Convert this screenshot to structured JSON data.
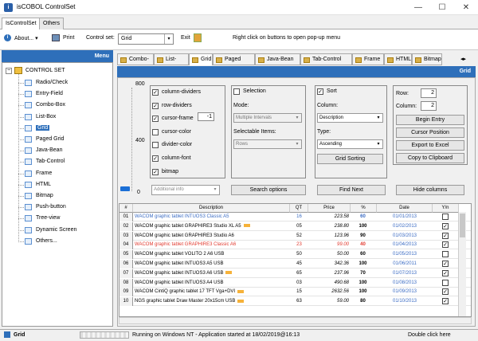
{
  "window": {
    "title": "isCOBOL ControlSet",
    "min": "—",
    "max": "☐",
    "close": "✕"
  },
  "top_tabs": [
    "IsControlSet",
    "Others"
  ],
  "toolbar": {
    "about": "About...",
    "print": "Print",
    "control_set_label": "Control set:",
    "control_set_value": "Grid",
    "exit": "Exit",
    "hint": "Right click on buttons to open pop-up menu"
  },
  "menu_header": "Menu",
  "tree": {
    "root": "CONTROL SET",
    "items": [
      "Radio/Check",
      "Entry-Field",
      "Combo-Box",
      "List-Box",
      "Grid",
      "Paged Grid",
      "Java-Bean",
      "Tab-Control",
      "Frame",
      "HTML",
      "Bitmap",
      "Push-button",
      "Tree-view",
      "Dynamic Screen",
      "Others..."
    ]
  },
  "content_tabs": [
    "Combo-Box",
    "List-Box",
    "Grid",
    "Paged Grid",
    "Java-Bean",
    "Tab-Control",
    "Frame",
    "HTML",
    "Bitmap"
  ],
  "grid_header": "Grid",
  "slider": {
    "ticks": [
      "800",
      "400",
      "0"
    ]
  },
  "options": {
    "checks": [
      {
        "label": "column-dividers",
        "checked": true
      },
      {
        "label": "row-dividers",
        "checked": true
      },
      {
        "label": "cursor-frame",
        "checked": true
      },
      {
        "label": "cursor-color",
        "checked": false
      },
      {
        "label": "divider-color",
        "checked": false
      },
      {
        "label": "column-font",
        "checked": true
      },
      {
        "label": "bitmap",
        "checked": true
      }
    ],
    "cursor_frame_value": "-1",
    "additional_info_placeholder": "Additional info"
  },
  "selection": {
    "label": "Selection",
    "mode_label": "Mode:",
    "mode_value": "Multiple Intervals",
    "selectable_label": "Selectable Items:",
    "selectable_value": "Rows",
    "search_button": "Search options"
  },
  "sort": {
    "label": "Sort",
    "column_label": "Column:",
    "column_value": "Description",
    "type_label": "Type:",
    "type_value": "Ascending",
    "sorting_button": "Grid Sorting",
    "find_button": "Find Next"
  },
  "cursor": {
    "row_label": "Row:",
    "row_value": "2",
    "column_label": "Column:",
    "column_value": "2",
    "begin_entry": "Begin Entry",
    "cursor_position": "Cursor Position",
    "export_excel": "Export to Excel",
    "copy_clipboard": "Copy to Clipboard",
    "hide_columns": "Hide columns"
  },
  "table": {
    "columns": [
      "#",
      "Description",
      "QT",
      "Price",
      "%",
      "Date",
      "Y/n"
    ],
    "rows": [
      {
        "n": "01",
        "desc": "WACOM graphic tablet INTUOS3 Classic A5",
        "qt": "16",
        "price": "223.58",
        "pct": "60",
        "date": "01/01/2013",
        "yn": false,
        "style": "blue",
        "new": false
      },
      {
        "n": "02",
        "desc": "WACOM graphic tablet GRAPHIRE3 Studio XL A5",
        "qt": "05",
        "price": "238.80",
        "pct": "100",
        "date": "01/02/2013",
        "yn": true,
        "style": "normal",
        "new": true
      },
      {
        "n": "03",
        "desc": "WACOM graphic tablet GRAPHIRE3 Studio A6",
        "qt": "52",
        "price": "123.96",
        "pct": "90",
        "date": "01/03/2013",
        "yn": true,
        "style": "normal",
        "new": false
      },
      {
        "n": "04",
        "desc": "WACOM graphic tablet GRAPHIRE3 Classic A6",
        "qt": "23",
        "price": "99.00",
        "pct": "40",
        "date": "01/04/2013",
        "yn": true,
        "style": "red",
        "new": false
      },
      {
        "n": "05",
        "desc": "WACOM graphic tablet VOLITO 2 A6 USB",
        "qt": "50",
        "price": "50.00",
        "pct": "60",
        "date": "01/05/2013",
        "yn": false,
        "style": "normal",
        "new": false
      },
      {
        "n": "06",
        "desc": "WACOM graphic tablet INTUOS3 A5 USB",
        "qt": "45",
        "price": "342.36",
        "pct": "100",
        "date": "01/06/2011",
        "yn": true,
        "style": "normal",
        "new": false
      },
      {
        "n": "07",
        "desc": "WACOM graphic tablet INTUOS3 A6 USB",
        "qt": "65",
        "price": "237.96",
        "pct": "70",
        "date": "01/07/2013",
        "yn": true,
        "style": "normal",
        "new": true
      },
      {
        "n": "08",
        "desc": "WACOM graphic tablet INTUOS3 A4 USB",
        "qt": "03",
        "price": "490.68",
        "pct": "100",
        "date": "01/08/2013",
        "yn": false,
        "style": "normal",
        "new": false
      },
      {
        "n": "09",
        "desc": "WACOM CintiQ graphic tablet 17 TFT Vga+DVI",
        "qt": "15",
        "price": "2632.56",
        "pct": "100",
        "date": "01/09/2013",
        "yn": true,
        "style": "normal",
        "new": true
      },
      {
        "n": "10",
        "desc": "NGS graphic tablet Draw Master 20x15cm USB",
        "qt": "63",
        "price": "59.00",
        "pct": "80",
        "date": "01/10/2013",
        "yn": true,
        "style": "normal",
        "new": true
      }
    ]
  },
  "statusbar": {
    "current": "Grid",
    "message": "Running on Windows NT  - Application started at 18/02/2019@16:13",
    "hint": "Double click here"
  },
  "colors": {
    "accent": "#2e6fba",
    "blue_text": "#3b6cc4",
    "red_text": "#e23a2f",
    "date_text": "#3b6cc4"
  }
}
